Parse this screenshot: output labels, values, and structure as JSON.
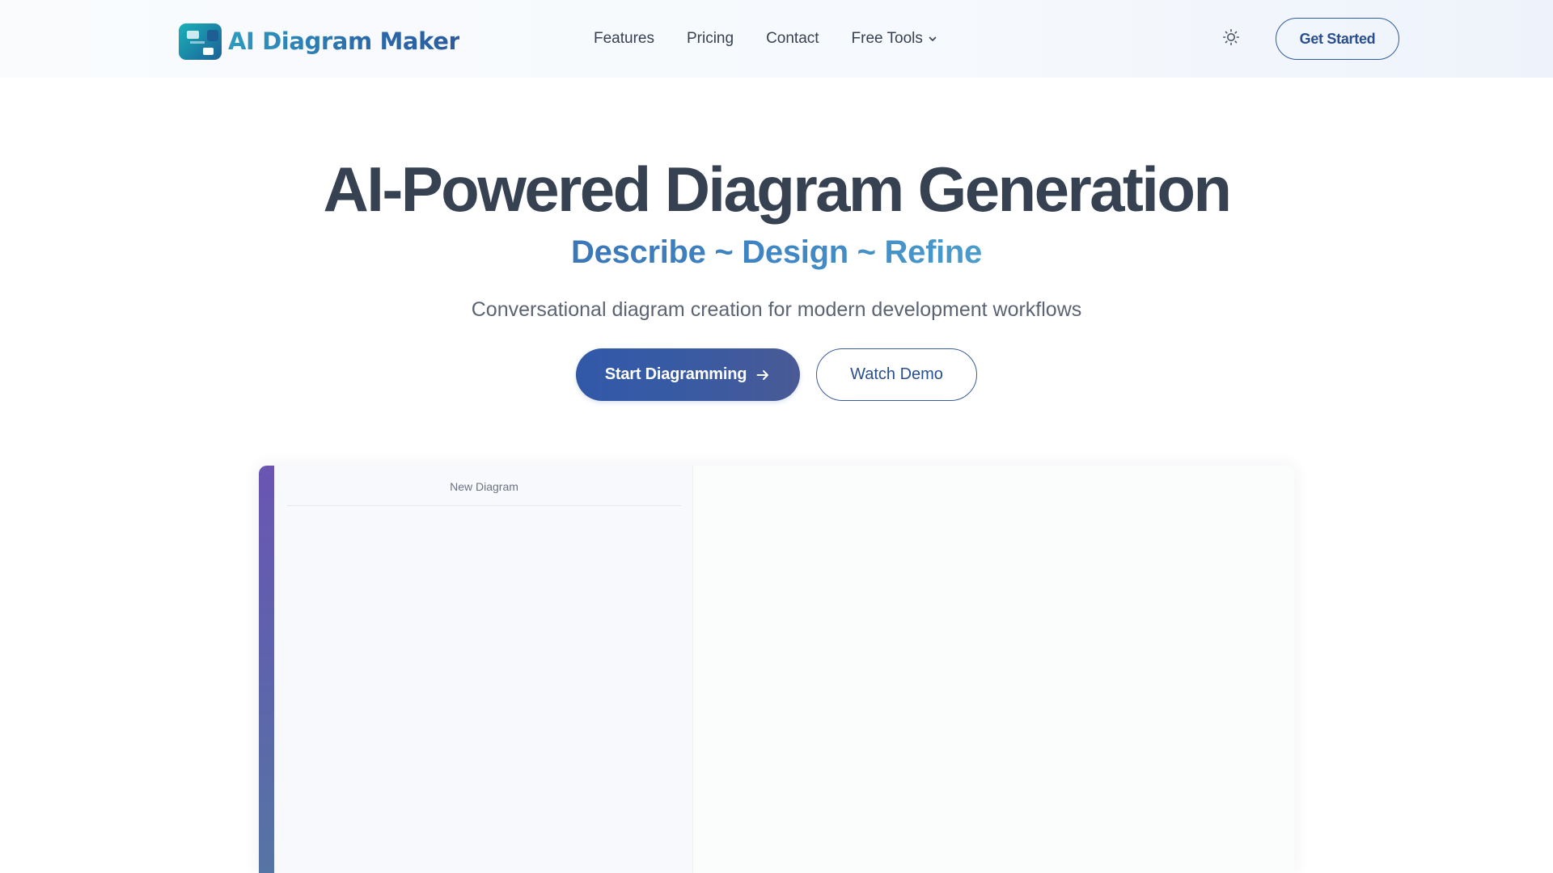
{
  "header": {
    "logo_text": "AI Diagram Maker",
    "nav": [
      {
        "label": "Features"
      },
      {
        "label": "Pricing"
      },
      {
        "label": "Contact"
      },
      {
        "label": "Free Tools"
      }
    ],
    "theme_toggle_icon": "sun-icon",
    "get_started_label": "Get Started"
  },
  "hero": {
    "title": "AI-Powered Diagram Generation",
    "tagline": "Describe ~ Design ~ Refine",
    "subtitle": "Conversational diagram creation for modern development workflows",
    "primary_cta": "Start Diagramming",
    "secondary_cta": "Watch Demo"
  },
  "preview": {
    "sidebar_title": "New Diagram"
  },
  "colors": {
    "brand_blue": "#2f5b9c",
    "accent_gradient_start": "#6a55b3",
    "heading": "#364152",
    "tagline": "#3f86c4"
  }
}
